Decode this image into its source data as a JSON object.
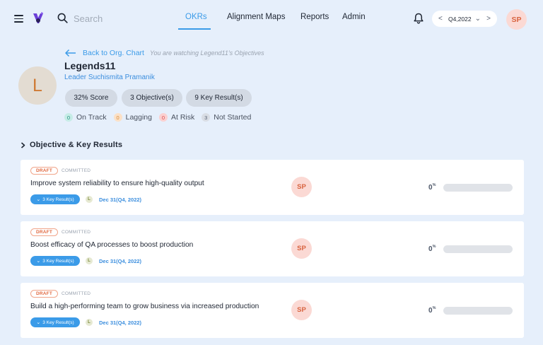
{
  "topbar": {
    "search_placeholder": "Search",
    "nav": [
      {
        "label": "OKRs",
        "active": true
      },
      {
        "label": "Alignment Maps",
        "active": false
      },
      {
        "label": "Reports",
        "active": false
      },
      {
        "label": "Admin",
        "active": false
      }
    ],
    "period": {
      "prev": "<",
      "value": "Q4,2022",
      "dropdown": "⌄",
      "next": ">"
    },
    "user_initials": "SP"
  },
  "header": {
    "back_label": "Back to Org. Chart",
    "watching_note": "You are watching Legend11's Objectives",
    "avatar_letter": "L",
    "name": "Legends11",
    "leader": "Leader Suchismita Pramanik",
    "pills": [
      "32% Score",
      "3 Objective(s)",
      "9 Key Result(s)"
    ],
    "statuses": [
      {
        "count": "0",
        "label": "On Track",
        "bg": "#c6ece6",
        "color": "#1f8f7e"
      },
      {
        "count": "0",
        "label": "Lagging",
        "bg": "#fbe0c6",
        "color": "#d68a3a"
      },
      {
        "count": "0",
        "label": "At Risk",
        "bg": "#fbd0d0",
        "color": "#d94b4b"
      },
      {
        "count": "3",
        "label": "Not Started",
        "bg": "#d9dde4",
        "color": "#5a6475"
      }
    ]
  },
  "section": {
    "title": "Objective & Key Results"
  },
  "objectives": [
    {
      "status": "DRAFT",
      "commitment": "COMMITTED",
      "title": "Improve system reliability to ensure high-quality output",
      "key_results": "3 Key Result(s)",
      "lead_initial": "L",
      "due": "Dec 31(Q4, 2022)",
      "owner": "SP",
      "progress": "0",
      "progress_unit": "%",
      "progress_fraction": 0
    },
    {
      "status": "DRAFT",
      "commitment": "COMMITTED",
      "title": "Boost efficacy of QA processes to boost production",
      "key_results": "3 Key Result(s)",
      "lead_initial": "L",
      "due": "Dec 31(Q4, 2022)",
      "owner": "SP",
      "progress": "0",
      "progress_unit": "%",
      "progress_fraction": 0
    },
    {
      "status": "DRAFT",
      "commitment": "COMMITTED",
      "title": "Build a high-performing team to grow business via increased production",
      "key_results": "3 Key Result(s)",
      "lead_initial": "L",
      "due": "Dec 31(Q4, 2022)",
      "owner": "SP",
      "progress": "0",
      "progress_unit": "%",
      "progress_fraction": 0
    }
  ],
  "colors": {
    "accent": "#3b9be8",
    "page_bg": "#e6effb",
    "owner_bg": "#fbd9d4",
    "owner_text": "#d8633f"
  }
}
